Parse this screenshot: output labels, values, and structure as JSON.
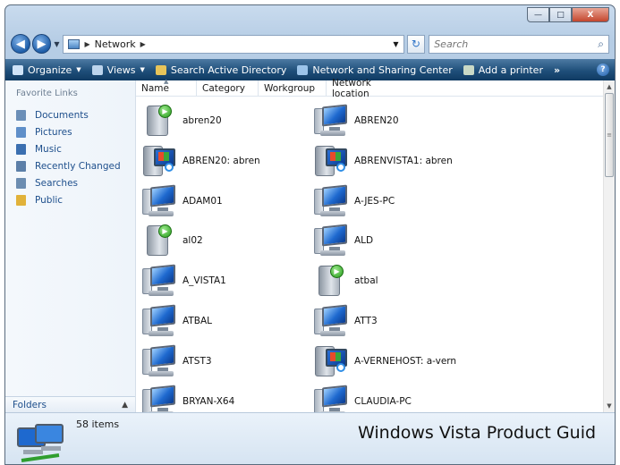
{
  "window": {
    "buttons": {
      "minimize": "—",
      "maximize": "□",
      "close": "X"
    }
  },
  "address": {
    "back_glyph": "◀",
    "forward_glyph": "▶",
    "location": "Network",
    "refresh_glyph": "↻",
    "search_placeholder": "Search"
  },
  "toolbar": {
    "organize": "Organize",
    "views": "Views",
    "search_ad": "Search Active Directory",
    "network_sharing": "Network and Sharing Center",
    "add_printer": "Add a printer",
    "more": "»",
    "help": "?"
  },
  "nav": {
    "favorite_title": "Favorite Links",
    "items": [
      {
        "label": "Documents",
        "color": "#6b8fb8"
      },
      {
        "label": "Pictures",
        "color": "#5f8fc9"
      },
      {
        "label": "Music",
        "color": "#3b6fb0"
      },
      {
        "label": "Recently Changed",
        "color": "#5c7fa8"
      },
      {
        "label": "Searches",
        "color": "#6c8db1"
      },
      {
        "label": "Public",
        "color": "#e1b23a"
      }
    ],
    "folders_label": "Folders"
  },
  "columns": [
    "Name",
    "Category",
    "Workgroup",
    "Network location"
  ],
  "items": [
    {
      "name": "abren20",
      "icon": "media-device-icon"
    },
    {
      "name": "ABREN20",
      "icon": "computer-icon"
    },
    {
      "name": "ABREN20: abren",
      "icon": "media-center-icon"
    },
    {
      "name": "ABRENVISTA1: abren",
      "icon": "media-center-icon"
    },
    {
      "name": "ADAM01",
      "icon": "computer-icon"
    },
    {
      "name": "A-JES-PC",
      "icon": "computer-icon"
    },
    {
      "name": "al02",
      "icon": "media-device-icon"
    },
    {
      "name": "ALD",
      "icon": "computer-icon"
    },
    {
      "name": "A_VISTA1",
      "icon": "computer-icon"
    },
    {
      "name": "atbal",
      "icon": "media-device-icon"
    },
    {
      "name": "ATBAL",
      "icon": "computer-icon"
    },
    {
      "name": "ATT3",
      "icon": "computer-icon"
    },
    {
      "name": "ATST3",
      "icon": "computer-icon"
    },
    {
      "name": "A-VERNEHOST: a-vern",
      "icon": "media-center-icon"
    },
    {
      "name": "BRYAN-X64",
      "icon": "computer-icon"
    },
    {
      "name": "CLAUDIA-PC",
      "icon": "computer-icon"
    }
  ],
  "status": {
    "count": "58 items"
  },
  "watermark": "Windows Vista Product Guid"
}
